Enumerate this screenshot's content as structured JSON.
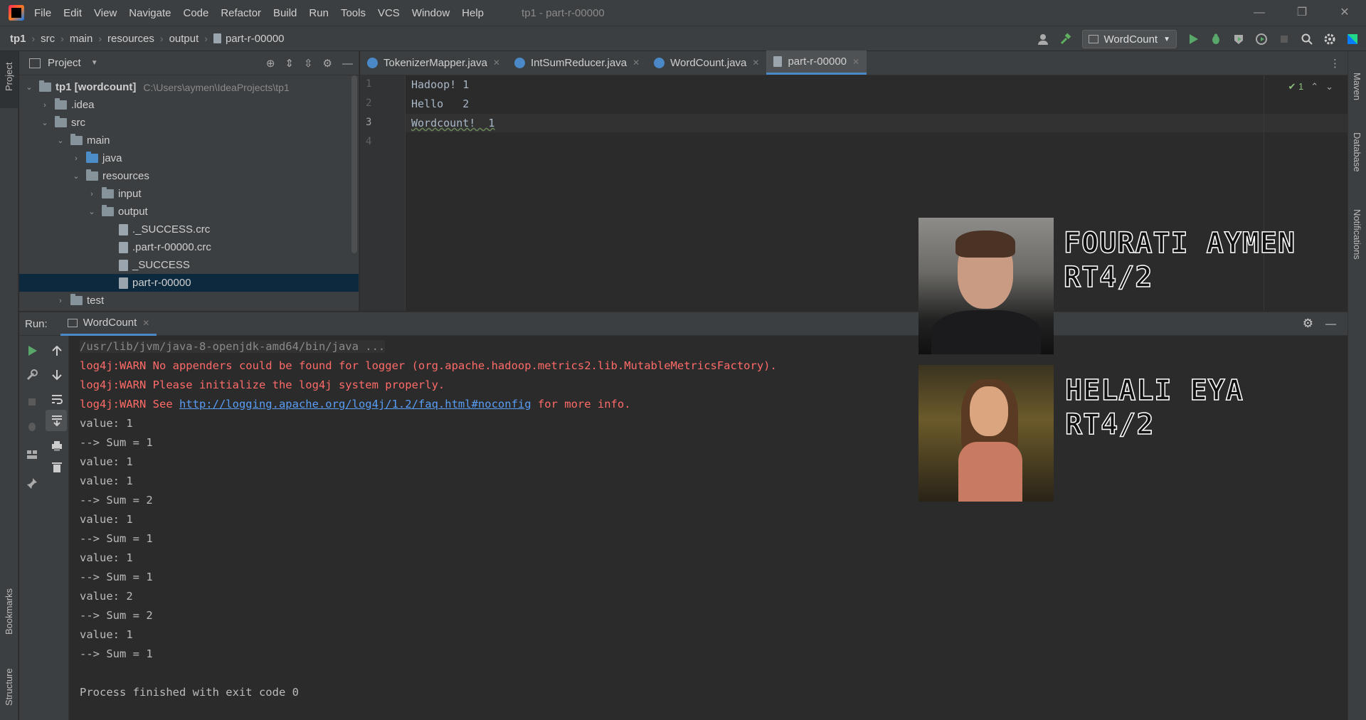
{
  "menubar": {
    "items": [
      "File",
      "Edit",
      "View",
      "Navigate",
      "Code",
      "Refactor",
      "Build",
      "Run",
      "Tools",
      "VCS",
      "Window",
      "Help"
    ],
    "window_title": "tp1 - part-r-00000",
    "controls": [
      "—",
      "❐",
      "✕"
    ]
  },
  "breadcrumbs": [
    "tp1",
    "src",
    "main",
    "resources",
    "output",
    "part-r-00000"
  ],
  "toolbar": {
    "run_config": "WordCount"
  },
  "project": {
    "header": "Project",
    "tree": [
      {
        "label": "tp1 [wordcount]",
        "hint": "C:\\Users\\aymen\\IdeaProjects\\tp1"
      },
      {
        "label": ".idea"
      },
      {
        "label": "src"
      },
      {
        "label": "main"
      },
      {
        "label": "java"
      },
      {
        "label": "resources"
      },
      {
        "label": "input"
      },
      {
        "label": "output"
      },
      {
        "label": "._SUCCESS.crc"
      },
      {
        "label": ".part-r-00000.crc"
      },
      {
        "label": "_SUCCESS"
      },
      {
        "label": "part-r-00000"
      },
      {
        "label": "test"
      }
    ]
  },
  "editor": {
    "tabs": [
      "TokenizerMapper.java",
      "IntSumReducer.java",
      "WordCount.java",
      "part-r-00000"
    ],
    "active_tab": "part-r-00000",
    "line_numbers": [
      "1",
      "2",
      "3",
      "4"
    ],
    "lines": [
      "Hadoop! 1",
      "Hello   2",
      "Wordcount!  1",
      ""
    ],
    "inspection": "✔ 1"
  },
  "overlay": {
    "person1_line1": "FOURATI AYMEN",
    "person1_line2": "RT4/2",
    "person2_line1": "HELALI EYA",
    "person2_line2": "RT4/2"
  },
  "run": {
    "label": "Run:",
    "tab": "WordCount",
    "console": {
      "cmd": "/usr/lib/jvm/java-8-openjdk-amd64/bin/java ...",
      "warn1": "log4j:WARN No appenders could be found for logger (org.apache.hadoop.metrics2.lib.MutableMetricsFactory).",
      "warn2": "log4j:WARN Please initialize the log4j system properly.",
      "warn3_prefix": "log4j:WARN See ",
      "warn3_link": "http://logging.apache.org/log4j/1.2/faq.html#noconfig",
      "warn3_suffix": " for more info.",
      "output": [
        "value: 1",
        "--> Sum = 1",
        "value: 1",
        "value: 1",
        "--> Sum = 2",
        "value: 1",
        "--> Sum = 1",
        "value: 1",
        "--> Sum = 1",
        "value: 2",
        "--> Sum = 2",
        "value: 1",
        "--> Sum = 1"
      ],
      "exit": "Process finished with exit code 0"
    }
  },
  "side_labels": {
    "left": [
      "Project",
      "Bookmarks",
      "Structure"
    ],
    "right": [
      "Maven",
      "Database",
      "Notifications"
    ]
  }
}
